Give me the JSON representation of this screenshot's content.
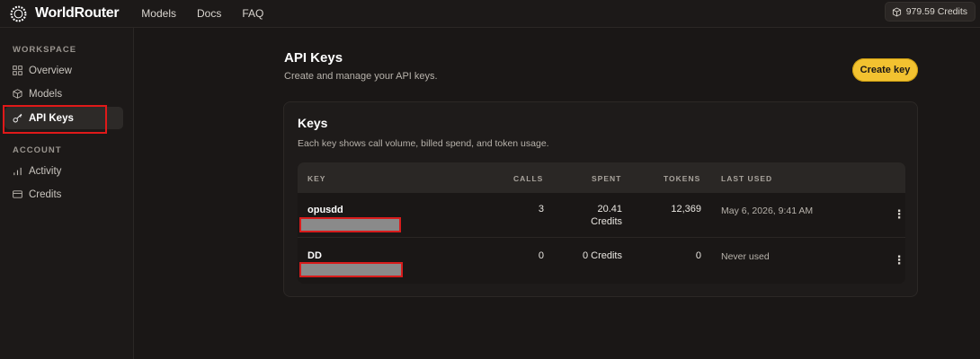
{
  "app": {
    "name": "WorldRouter",
    "nav": [
      "Models",
      "Docs",
      "FAQ"
    ],
    "credits_label": "979.59 Credits"
  },
  "sidebar": {
    "workspace_label": "WORKSPACE",
    "workspace_items": [
      {
        "label": "Overview",
        "icon": "grid-icon"
      },
      {
        "label": "Models",
        "icon": "cube-icon"
      },
      {
        "label": "API Keys",
        "icon": "key-icon",
        "active": true
      }
    ],
    "account_label": "ACCOUNT",
    "account_items": [
      {
        "label": "Activity",
        "icon": "bar-chart-icon"
      },
      {
        "label": "Credits",
        "icon": "card-icon"
      }
    ]
  },
  "main": {
    "title": "API Keys",
    "subtitle": "Create and manage your API keys.",
    "create_button": "Create key"
  },
  "keys_card": {
    "title": "Keys",
    "subtitle": "Each key shows call volume, billed spend, and token usage.",
    "columns": [
      "KEY",
      "CALLS",
      "SPENT",
      "TOKENS",
      "LAST USED"
    ],
    "rows": [
      {
        "name": "opusdd",
        "calls": "3",
        "spent_line1": "20.41",
        "spent_line2": "Credits",
        "tokens": "12,369",
        "last_used": "May 6, 2026, 9:41 AM"
      },
      {
        "name": "DD",
        "calls": "0",
        "spent_line1": "0 Credits",
        "spent_line2": "",
        "tokens": "0",
        "last_used": "Never used"
      }
    ]
  },
  "colors": {
    "accent": "#f2c230",
    "highlight": "#e01919",
    "background": "#1a1716"
  }
}
